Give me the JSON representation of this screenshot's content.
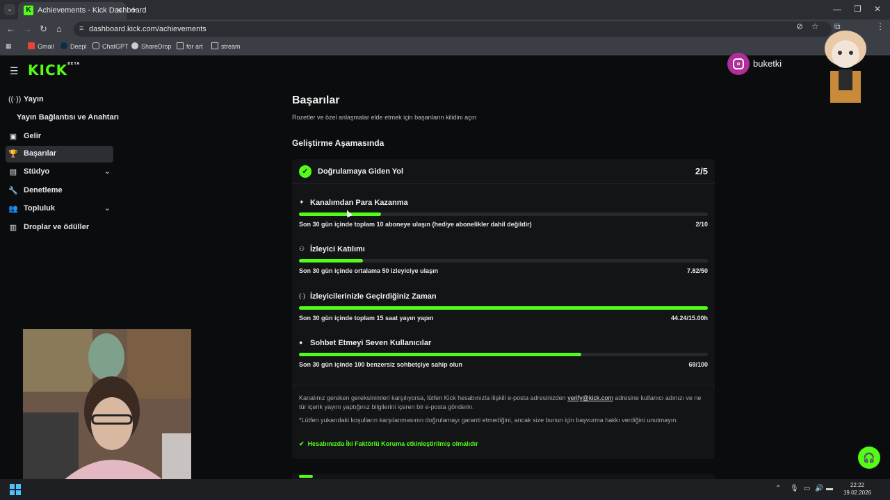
{
  "browser": {
    "tab_title": "Achievements - Kick Dashboard",
    "tab_favicon": "K",
    "url": "dashboard.kick.com/achievements",
    "bookmarks": [
      "Gmail",
      "Deepl",
      "ChatGPT",
      "ShareDrop",
      "for art",
      "stream"
    ]
  },
  "app": {
    "logo": "KICK",
    "logo_badge": "BETA"
  },
  "sidebar": {
    "items": [
      {
        "icon": "broadcast-icon",
        "label": "Yayın"
      },
      {
        "icon": "",
        "label": "Yayın Bağlantısı ve Anahtarı"
      },
      {
        "icon": "revenue-icon",
        "label": "Gelir"
      },
      {
        "icon": "trophy-icon",
        "label": "Başarılar",
        "active": true
      },
      {
        "icon": "studio-icon",
        "label": "Stüdyo"
      },
      {
        "icon": "wrench-icon",
        "label": "Denetleme"
      },
      {
        "icon": "community-icon",
        "label": "Topluluk"
      },
      {
        "icon": "gift-icon",
        "label": "Droplar ve ödüller"
      }
    ]
  },
  "main": {
    "title": "Başarılar",
    "subtitle": "Rozetler ve özel anlaşmalar elde etmek için başarıların kilidini açın",
    "section_title": "Geliştirme Aşamasında",
    "card": {
      "title": "Doğrulamaya Giden Yol",
      "count": "2/5",
      "achievements": [
        {
          "title": "Kanalımdan Para Kazanma",
          "desc": "Son 30 gün içinde toplam 10 aboneye ulaşın (hediye abonelikler dahil değildir)",
          "value": "2/10",
          "progress": 0.2
        },
        {
          "title": "İzleyici Katılımı",
          "desc": "Son 30 gün içinde ortalama 50 izleyiciye ulaşın",
          "value": "7.82/50",
          "progress": 0.156
        },
        {
          "title": "İzleyicilerinizle Geçirdiğiniz Zaman",
          "desc": "Son 30 gün içinde toplam 15 saat yayın yapın",
          "value": "44.24/15.00h",
          "progress": 1.0
        },
        {
          "title": "Sohbet Etmeyi Seven Kullanıcılar",
          "desc": "Son 30 gün içinde 100 benzersiz sohbetçiye sahip olun",
          "value": "69/100",
          "progress": 0.69
        }
      ],
      "note_part1": "Kanalınız gereken gereksinimleri karşılıyorsa, lütfen Kick hesabınızla ilişkili e-posta adresinizden ",
      "note_link": "verify@kick.com",
      "note_part2": " adresine kullanıcı adınızı ve ne tür içerik yayını yaptığınız bilgilerini içeren bir e-posta gönderin.",
      "note_disclaimer": "*Lütfen yukarıdaki koşulların karşılanmasının doğrulamayı garanti etmediğini, ancak size bunun için başvurma hakkı verdiğini unutmayın.",
      "requirement": "Hesabınızda İki Faktörlü Koruma etkinleştirilmiş olmalıdır"
    }
  },
  "overlay": {
    "instagram_handle": "buketki"
  },
  "taskbar": {
    "time": "22:22",
    "date": "19.02.2026"
  },
  "colors": {
    "accent": "#53fc18",
    "background": "#0b0c0d",
    "card": "#131416"
  }
}
